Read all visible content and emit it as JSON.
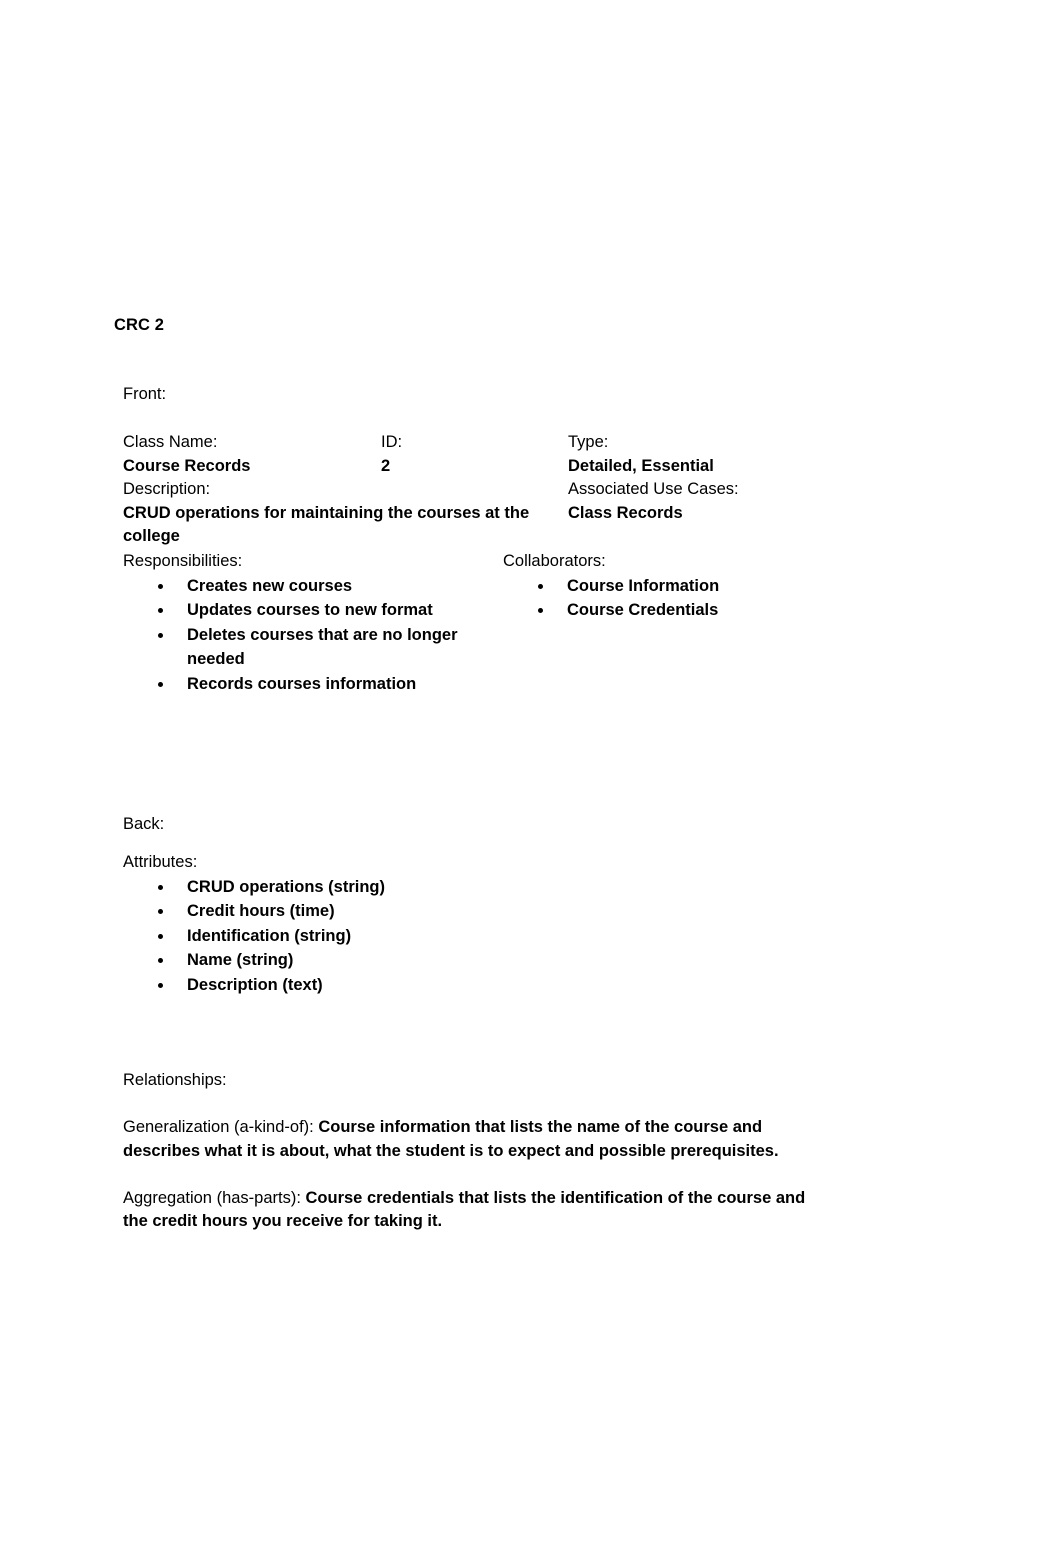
{
  "document": {
    "title": "CRC 2"
  },
  "front": {
    "section_label": "Front:",
    "fields": {
      "class_name_label": "Class Name:",
      "class_name_value": "Course Records",
      "id_label": "ID:",
      "id_value": "2",
      "type_label": "Type:",
      "type_value": "Detailed, Essential",
      "description_label": "Description:",
      "description_value": "CRUD operations for maintaining the courses at the college",
      "associated_use_cases_label": "Associated Use Cases:",
      "associated_use_cases_value": "Class Records"
    },
    "responsibilities_label": "Responsibilities:",
    "responsibilities": [
      "Creates new courses",
      "Updates courses to new format",
      "Deletes courses that are no longer needed",
      "Records courses information"
    ],
    "collaborators_label": "Collaborators:",
    "collaborators": [
      "Course Information",
      "Course Credentials"
    ]
  },
  "back": {
    "section_label": "Back:",
    "attributes_label": "Attributes:",
    "attributes": [
      "CRUD operations (string)",
      "Credit hours (time)",
      "Identification (string)",
      "Name (string)",
      "Description (text)"
    ],
    "relationships_label": "Relationships:",
    "relationships": [
      {
        "label": "Generalization (a-kind-of): ",
        "value": "Course information that lists the name of the course and describes what it is about, what the student is to expect and possible prerequisites."
      },
      {
        "label": "Aggregation (has-parts): ",
        "value": "Course credentials that lists the identification of the course and the credit hours you receive for taking it."
      }
    ]
  }
}
